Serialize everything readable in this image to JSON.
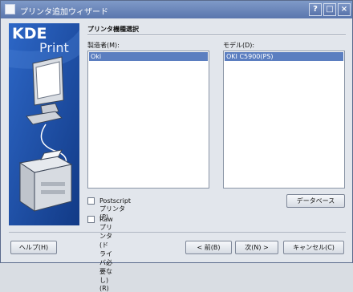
{
  "window": {
    "title": "プリンタ追加ウィザード",
    "buttons": {
      "help": "?",
      "maximize": "□",
      "close": "×"
    }
  },
  "sidebar": {
    "logo_line1": "KDE",
    "logo_line2": "Print"
  },
  "section": {
    "title": "プリンタ機種選択"
  },
  "manufacturer": {
    "label": "製造者(M):",
    "items": [
      "Oki"
    ]
  },
  "model": {
    "label": "モデル(D):",
    "items": [
      "OKI C5900(PS)"
    ]
  },
  "database_button": "データベース",
  "options": {
    "postscript": "Postscriptプリンタ(P)",
    "raw": "Rawプリンタ(ドライバ必要なし)(R)"
  },
  "footer": {
    "help": "ヘルプ(H)",
    "back": "< 前(B)",
    "next": "次(N) >",
    "cancel": "キャンセル(C)"
  }
}
